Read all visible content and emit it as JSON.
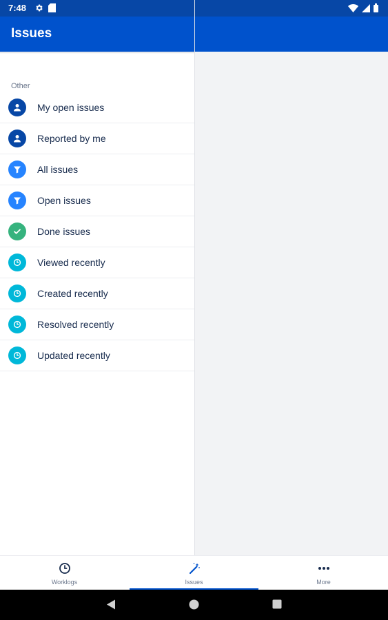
{
  "status_bar": {
    "time": "7:48",
    "icons": [
      "settings-icon",
      "sd-card-icon",
      "wifi-icon",
      "signal-icon",
      "battery-icon"
    ]
  },
  "app_bar": {
    "title": "Issues"
  },
  "filters": {
    "section_label": "Other",
    "items": [
      {
        "label": "My open issues",
        "icon": "person-icon",
        "color": "#0747a6"
      },
      {
        "label": "Reported by me",
        "icon": "person-icon",
        "color": "#0747a6"
      },
      {
        "label": "All issues",
        "icon": "filter-icon",
        "color": "#2684ff"
      },
      {
        "label": "Open issues",
        "icon": "filter-icon",
        "color": "#2684ff"
      },
      {
        "label": "Done issues",
        "icon": "check-icon",
        "color": "#36b37e"
      },
      {
        "label": "Viewed recently",
        "icon": "clock-icon",
        "color": "#00b8d9"
      },
      {
        "label": "Created recently",
        "icon": "clock-icon",
        "color": "#00b8d9"
      },
      {
        "label": "Resolved recently",
        "icon": "clock-icon",
        "color": "#00b8d9"
      },
      {
        "label": "Updated recently",
        "icon": "clock-icon",
        "color": "#00b8d9"
      }
    ]
  },
  "bottom_nav": {
    "tabs": [
      {
        "label": "Worklogs",
        "icon": "clock-icon"
      },
      {
        "label": "Issues",
        "icon": "magic-wand-icon",
        "selected": true
      },
      {
        "label": "More",
        "icon": "more-dots-icon"
      }
    ]
  },
  "colors": {
    "status_bar": "#0747a6",
    "app_bar": "#0052cc",
    "accent": "#0052cc"
  }
}
